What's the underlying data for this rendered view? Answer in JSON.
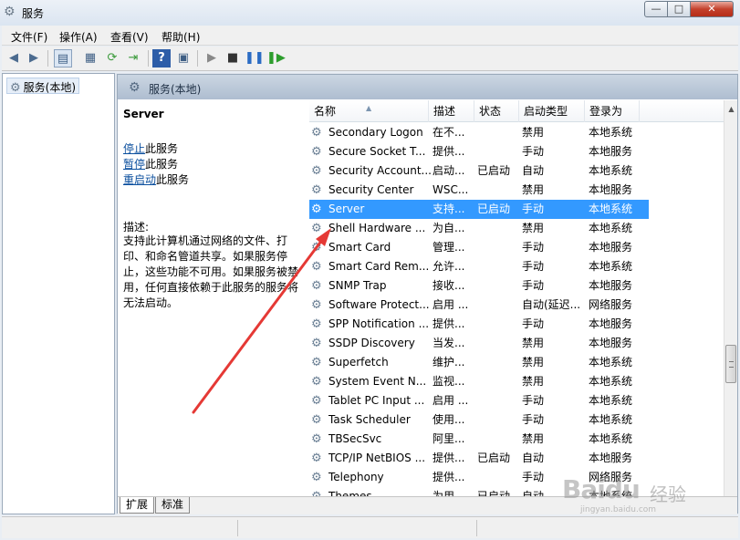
{
  "window": {
    "title": "服务",
    "min": "—",
    "max": "□",
    "close": "✕"
  },
  "menu": [
    {
      "label": "文件(F)"
    },
    {
      "label": "操作(A)"
    },
    {
      "label": "查看(V)"
    },
    {
      "label": "帮助(H)"
    }
  ],
  "toolbar": {
    "back_icon": "arrow-left-icon",
    "forward_icon": "arrow-right-icon",
    "show_tree_icon": "console-tree-icon",
    "properties_icon": "properties-icon",
    "refresh_icon": "refresh-icon",
    "export_icon": "export-list-icon",
    "help_icon": "help-icon",
    "view_icon": "view-icon",
    "start_icon": "play-icon",
    "stop_icon": "stop-icon",
    "pause_icon": "pause-icon",
    "restart_icon": "restart-icon"
  },
  "tree": {
    "label": "服务(本地)"
  },
  "pane": {
    "title": "服务(本地)"
  },
  "details": {
    "service_name": "Server",
    "actions": [
      {
        "link": "停止",
        "suffix": "此服务"
      },
      {
        "link": "暂停",
        "suffix": "此服务"
      },
      {
        "link": "重启动",
        "suffix": "此服务"
      }
    ],
    "desc_label": "描述:",
    "desc_text": "支持此计算机通过网络的文件、打印、和命名管道共享。如果服务停止，这些功能不可用。如果服务被禁用，任何直接依赖于此服务的服务将无法启动。"
  },
  "columns": {
    "name": "名称",
    "desc": "描述",
    "status": "状态",
    "startup": "启动类型",
    "logon": "登录为"
  },
  "services": [
    {
      "name": "Secondary Logon",
      "desc": "在不...",
      "status": "",
      "startup": "禁用",
      "logon": "本地系统"
    },
    {
      "name": "Secure Socket T...",
      "desc": "提供...",
      "status": "",
      "startup": "手动",
      "logon": "本地服务"
    },
    {
      "name": "Security Account...",
      "desc": "启动...",
      "status": "已启动",
      "startup": "自动",
      "logon": "本地系统"
    },
    {
      "name": "Security Center",
      "desc": "WSC...",
      "status": "",
      "startup": "禁用",
      "logon": "本地服务"
    },
    {
      "name": "Server",
      "desc": "支持...",
      "status": "已启动",
      "startup": "手动",
      "logon": "本地系统",
      "selected": true
    },
    {
      "name": "Shell Hardware ...",
      "desc": "为自...",
      "status": "",
      "startup": "禁用",
      "logon": "本地系统"
    },
    {
      "name": "Smart Card",
      "desc": "管理...",
      "status": "",
      "startup": "手动",
      "logon": "本地服务"
    },
    {
      "name": "Smart Card Rem...",
      "desc": "允许...",
      "status": "",
      "startup": "手动",
      "logon": "本地系统"
    },
    {
      "name": "SNMP Trap",
      "desc": "接收...",
      "status": "",
      "startup": "手动",
      "logon": "本地服务"
    },
    {
      "name": "Software Protect...",
      "desc": "启用 ...",
      "status": "",
      "startup": "自动(延迟...",
      "logon": "网络服务"
    },
    {
      "name": "SPP Notification ...",
      "desc": "提供...",
      "status": "",
      "startup": "手动",
      "logon": "本地服务"
    },
    {
      "name": "SSDP Discovery",
      "desc": "当发...",
      "status": "",
      "startup": "禁用",
      "logon": "本地服务"
    },
    {
      "name": "Superfetch",
      "desc": "维护...",
      "status": "",
      "startup": "禁用",
      "logon": "本地系统"
    },
    {
      "name": "System Event N...",
      "desc": "监视...",
      "status": "",
      "startup": "禁用",
      "logon": "本地系统"
    },
    {
      "name": "Tablet PC Input ...",
      "desc": "启用 ...",
      "status": "",
      "startup": "手动",
      "logon": "本地系统"
    },
    {
      "name": "Task Scheduler",
      "desc": "使用...",
      "status": "",
      "startup": "手动",
      "logon": "本地系统"
    },
    {
      "name": "TBSecSvc",
      "desc": "阿里...",
      "status": "",
      "startup": "禁用",
      "logon": "本地系统"
    },
    {
      "name": "TCP/IP NetBIOS ...",
      "desc": "提供...",
      "status": "已启动",
      "startup": "自动",
      "logon": "本地服务"
    },
    {
      "name": "Telephony",
      "desc": "提供...",
      "status": "",
      "startup": "手动",
      "logon": "网络服务"
    },
    {
      "name": "Themes",
      "desc": "为用...",
      "status": "已启动",
      "startup": "自动",
      "logon": "本地系统"
    }
  ],
  "tabs": [
    {
      "label": "扩展"
    },
    {
      "label": "标准"
    }
  ],
  "watermark": {
    "logo": "Baidu",
    "text": "经验",
    "url": "jingyan.baidu.com"
  },
  "colors": {
    "selection": "#3399ff",
    "link": "#0b4f9e",
    "arrow": "#e53935"
  }
}
